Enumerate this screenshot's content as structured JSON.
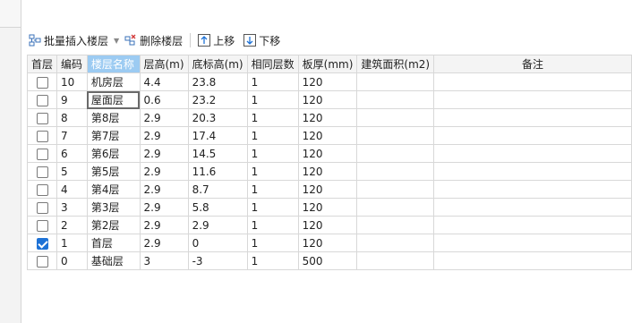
{
  "toolbar": {
    "batch_insert": "批量插入楼层",
    "delete_floor": "删除楼层",
    "move_up": "上移",
    "move_down": "下移"
  },
  "columns": [
    "首层",
    "编码",
    "楼层名称",
    "层高(m)",
    "底标高(m)",
    "相同层数",
    "板厚(mm)",
    "建筑面积(m2)",
    "备注"
  ],
  "rows": [
    {
      "first": false,
      "code": "10",
      "name": "机房层",
      "height": "4.4",
      "base": "23.8",
      "same": "1",
      "thick": "120",
      "area": "",
      "note": ""
    },
    {
      "first": false,
      "code": "9",
      "name": "屋面层",
      "height": "0.6",
      "base": "23.2",
      "same": "1",
      "thick": "120",
      "area": "",
      "note": ""
    },
    {
      "first": false,
      "code": "8",
      "name": "第8层",
      "height": "2.9",
      "base": "20.3",
      "same": "1",
      "thick": "120",
      "area": "",
      "note": ""
    },
    {
      "first": false,
      "code": "7",
      "name": "第7层",
      "height": "2.9",
      "base": "17.4",
      "same": "1",
      "thick": "120",
      "area": "",
      "note": ""
    },
    {
      "first": false,
      "code": "6",
      "name": "第6层",
      "height": "2.9",
      "base": "14.5",
      "same": "1",
      "thick": "120",
      "area": "",
      "note": ""
    },
    {
      "first": false,
      "code": "5",
      "name": "第5层",
      "height": "2.9",
      "base": "11.6",
      "same": "1",
      "thick": "120",
      "area": "",
      "note": ""
    },
    {
      "first": false,
      "code": "4",
      "name": "第4层",
      "height": "2.9",
      "base": "8.7",
      "same": "1",
      "thick": "120",
      "area": "",
      "note": ""
    },
    {
      "first": false,
      "code": "3",
      "name": "第3层",
      "height": "2.9",
      "base": "5.8",
      "same": "1",
      "thick": "120",
      "area": "",
      "note": ""
    },
    {
      "first": false,
      "code": "2",
      "name": "第2层",
      "height": "2.9",
      "base": "2.9",
      "same": "1",
      "thick": "120",
      "area": "",
      "note": ""
    },
    {
      "first": true,
      "code": "1",
      "name": "首层",
      "height": "2.9",
      "base": "0",
      "same": "1",
      "thick": "120",
      "area": "",
      "note": ""
    },
    {
      "first": false,
      "code": "0",
      "name": "基础层",
      "height": "3",
      "base": "-3",
      "same": "1",
      "thick": "500",
      "area": "",
      "note": ""
    }
  ],
  "colors": {
    "header_selected": "#9ccbf2",
    "checkbox_checked": "#1e72d6",
    "highlight_cell": "#fffbe6",
    "grid_line": "#d8d8d8"
  },
  "icons": [
    "insert-floors-icon",
    "delete-floor-icon",
    "move-up-icon",
    "move-down-icon"
  ]
}
